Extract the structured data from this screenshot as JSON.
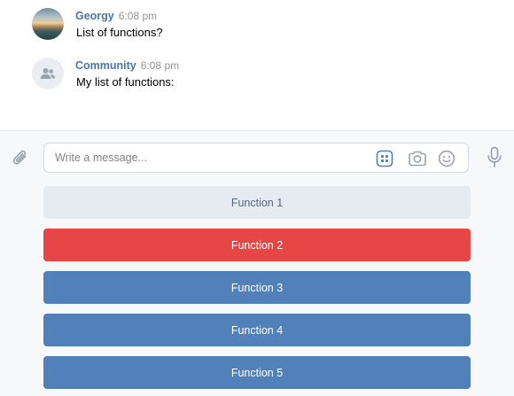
{
  "messages": [
    {
      "author": "Georgy",
      "time": "6:08 pm",
      "text": "List of functions?",
      "avatar": "user-photo-avatar"
    },
    {
      "author": "Community",
      "time": "6:08 pm",
      "text": "My list of functions:",
      "avatar": "community-avatar"
    }
  ],
  "composer": {
    "placeholder": "Write a message...",
    "icons": {
      "attach": "paperclip-icon",
      "keyboard": "bot-keyboard-icon",
      "camera": "camera-icon",
      "emoji": "emoji-icon",
      "mic": "microphone-icon"
    }
  },
  "keyboard": {
    "buttons": [
      {
        "label": "Function 1",
        "color": "secondary"
      },
      {
        "label": "Function 2",
        "color": "negative"
      },
      {
        "label": "Function 3",
        "color": "primary"
      },
      {
        "label": "Function 4",
        "color": "primary"
      },
      {
        "label": "Function 5",
        "color": "primary"
      }
    ]
  },
  "colors": {
    "author_link": "#4a76a8",
    "secondary_button": "#e5ebf1",
    "negative_button": "#e64646",
    "primary_button": "#5181b8",
    "icon_gray": "#99a2ad",
    "keyboard_icon_accent": "#5181b8",
    "composer_background": "#f7f8fa"
  }
}
